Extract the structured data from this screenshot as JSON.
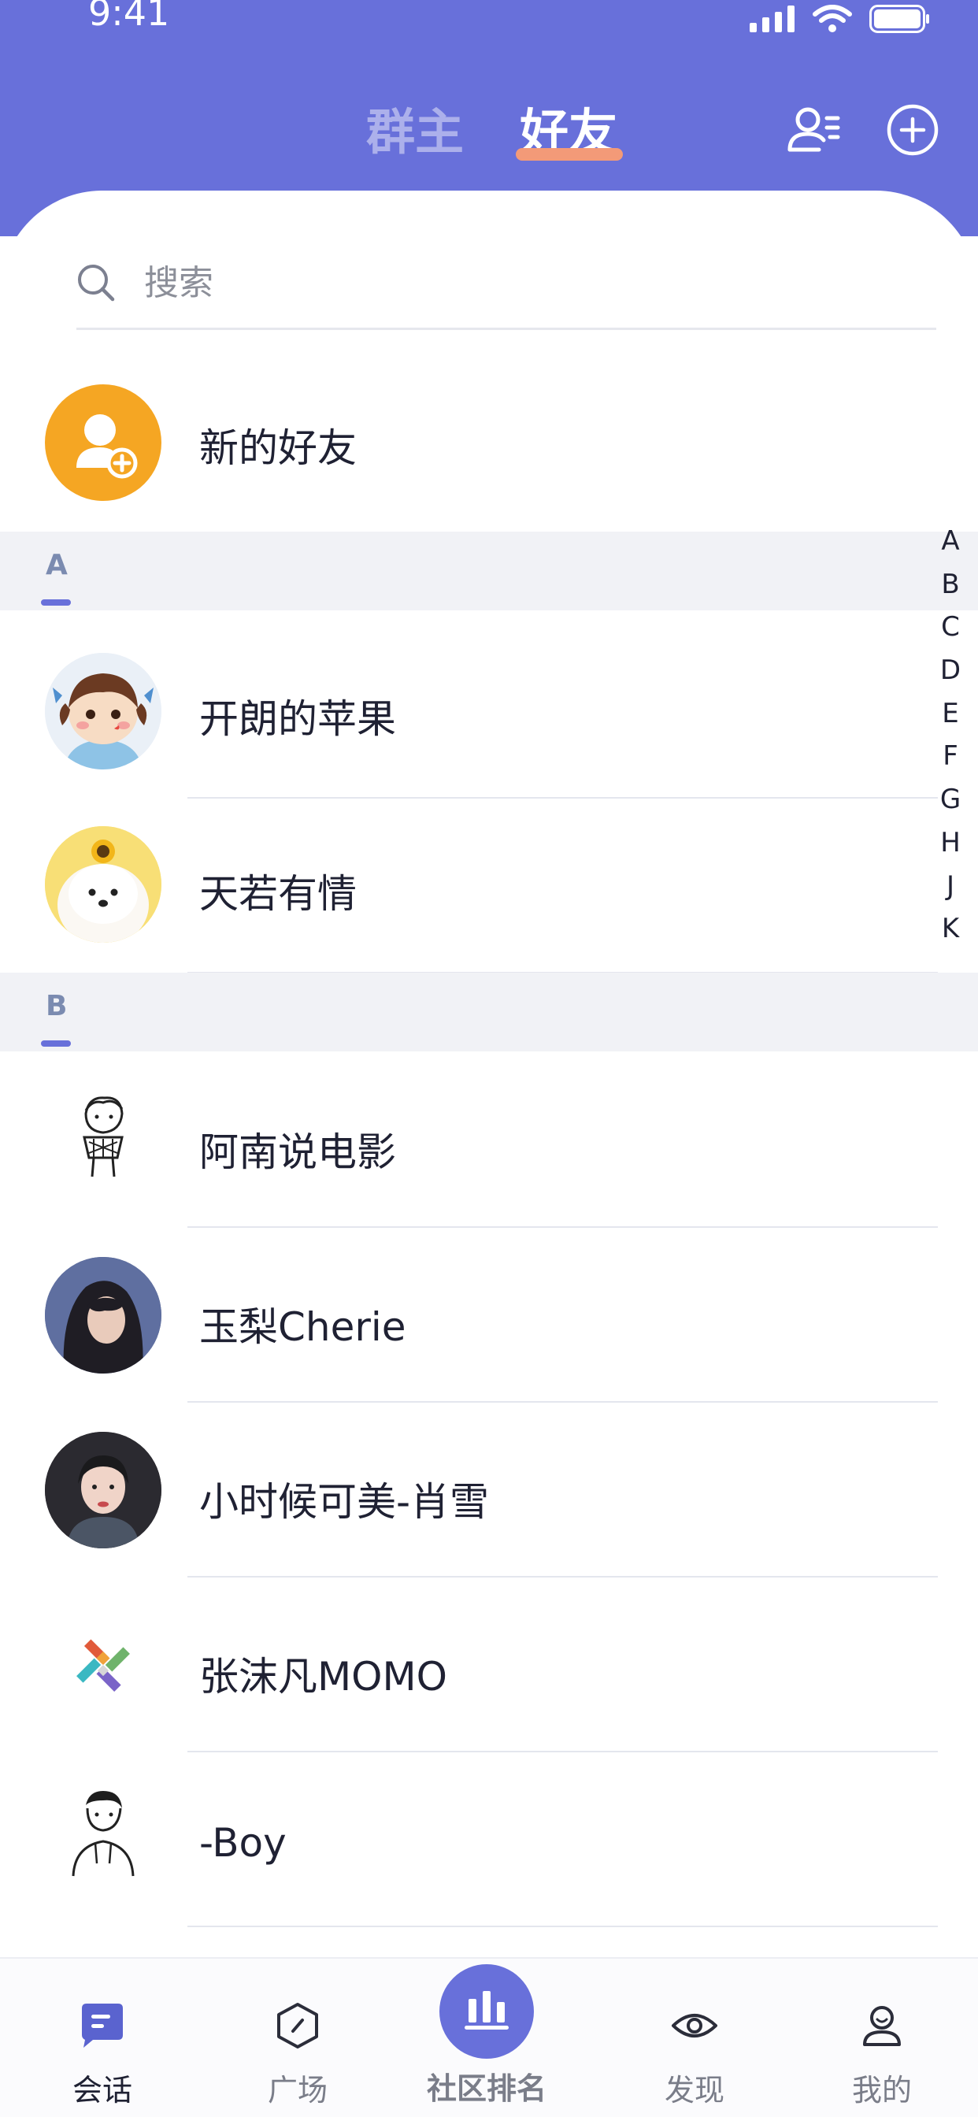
{
  "status_bar": {
    "time": "9:41"
  },
  "header": {
    "tabs": [
      {
        "label": "群主",
        "active": false
      },
      {
        "label": "好友",
        "active": true
      }
    ],
    "contacts_icon": "contacts-icon",
    "add_icon": "plus-circle-icon",
    "accent_color": "#6870da",
    "tab_underline_color": "#f39a78"
  },
  "search": {
    "placeholder": "搜索"
  },
  "new_friends": {
    "label": "新的好友",
    "icon_color": "#f5a623"
  },
  "sections": [
    {
      "letter": "A",
      "contacts": [
        {
          "name": "开朗的苹果"
        },
        {
          "name": "天若有情"
        }
      ]
    },
    {
      "letter": "B",
      "contacts": [
        {
          "name": "阿南说电影"
        },
        {
          "name": "玉梨Cherie"
        },
        {
          "name": "小时候可美-肖雪"
        },
        {
          "name": "张沫凡MOMO"
        },
        {
          "name": "-Boy"
        }
      ]
    }
  ],
  "alphabet_index": [
    "A",
    "B",
    "C",
    "D",
    "E",
    "F",
    "G",
    "H",
    "J",
    "K"
  ],
  "bottom_nav": [
    {
      "label": "会话",
      "icon": "chat-icon",
      "active": true
    },
    {
      "label": "广场",
      "icon": "compass-icon",
      "active": false
    },
    {
      "label": "社区排名",
      "icon": "bar-chart-icon",
      "active": false
    },
    {
      "label": "发现",
      "icon": "eye-icon",
      "active": false
    },
    {
      "label": "我的",
      "icon": "user-icon",
      "active": false
    }
  ]
}
